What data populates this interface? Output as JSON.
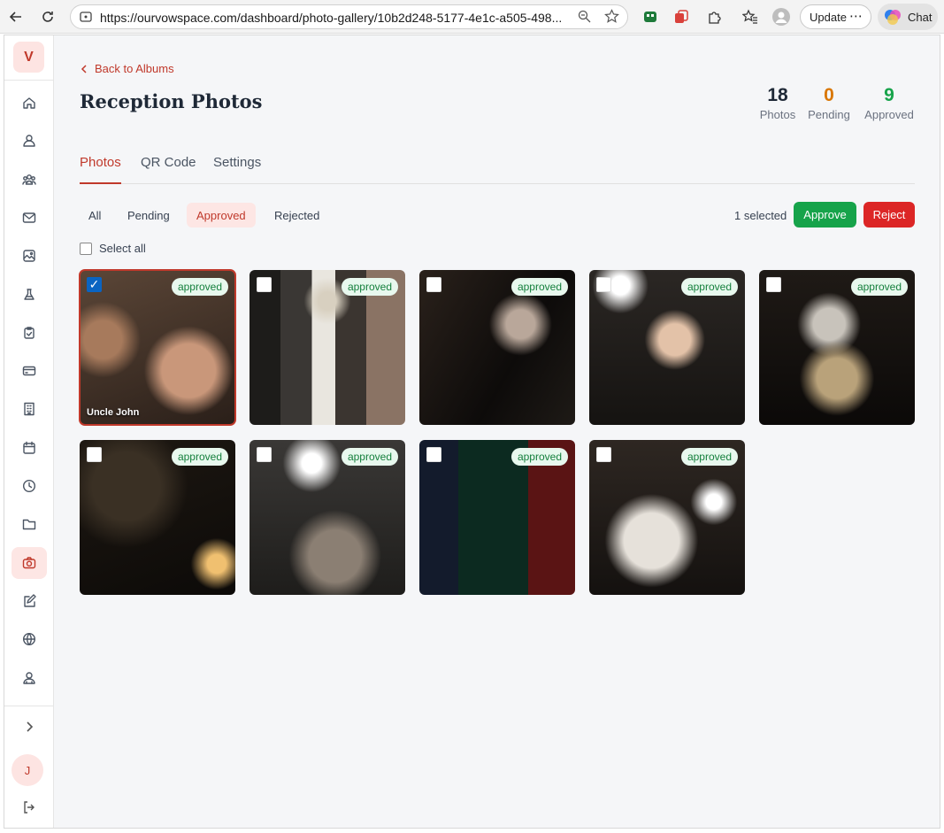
{
  "browser": {
    "url": "https://ourvowspace.com/dashboard/photo-gallery/10b2d248-5177-4e1c-a505-498...",
    "update_label": "Update",
    "chat_label": "Chat"
  },
  "sidebar": {
    "logo": "V",
    "avatar": "J",
    "items": [
      {
        "icon": "home-icon"
      },
      {
        "icon": "user-icon"
      },
      {
        "icon": "users-icon"
      },
      {
        "icon": "mail-icon"
      },
      {
        "icon": "image-icon"
      },
      {
        "icon": "flask-icon"
      },
      {
        "icon": "clipboard-check-icon"
      },
      {
        "icon": "card-icon"
      },
      {
        "icon": "building-icon"
      },
      {
        "icon": "calendar-icon"
      },
      {
        "icon": "clock-icon"
      },
      {
        "icon": "folder-icon"
      },
      {
        "icon": "camera-icon",
        "active": true
      },
      {
        "icon": "edit-icon"
      },
      {
        "icon": "globe-icon"
      },
      {
        "icon": "contacts-icon"
      }
    ]
  },
  "page": {
    "back_label": "Back to Albums",
    "title": "Reception Photos"
  },
  "stats": {
    "photos": {
      "value": "18",
      "label": "Photos",
      "color": "#1f2937"
    },
    "pending": {
      "value": "0",
      "label": "Pending",
      "color": "#d97706"
    },
    "approved": {
      "value": "9",
      "label": "Approved",
      "color": "#16a34a"
    }
  },
  "tabs": [
    "Photos",
    "QR Code",
    "Settings"
  ],
  "active_tab": "Photos",
  "filters": [
    "All",
    "Pending",
    "Approved",
    "Rejected"
  ],
  "active_filter": "Approved",
  "selection": {
    "count_label": "1 selected",
    "approve_label": "Approve",
    "reject_label": "Reject",
    "select_all_label": "Select all"
  },
  "colors": {
    "accent": "#c0392b",
    "approve": "#16a34a",
    "reject": "#dc2626"
  },
  "photos": [
    {
      "status": "approved",
      "selected": true,
      "caption": "Uncle John"
    },
    {
      "status": "approved",
      "selected": false,
      "caption": ""
    },
    {
      "status": "approved",
      "selected": false,
      "caption": ""
    },
    {
      "status": "approved",
      "selected": false,
      "caption": ""
    },
    {
      "status": "approved",
      "selected": false,
      "caption": ""
    },
    {
      "status": "approved",
      "selected": false,
      "caption": ""
    },
    {
      "status": "approved",
      "selected": false,
      "caption": ""
    },
    {
      "status": "approved",
      "selected": false,
      "caption": ""
    },
    {
      "status": "approved",
      "selected": false,
      "caption": ""
    }
  ]
}
